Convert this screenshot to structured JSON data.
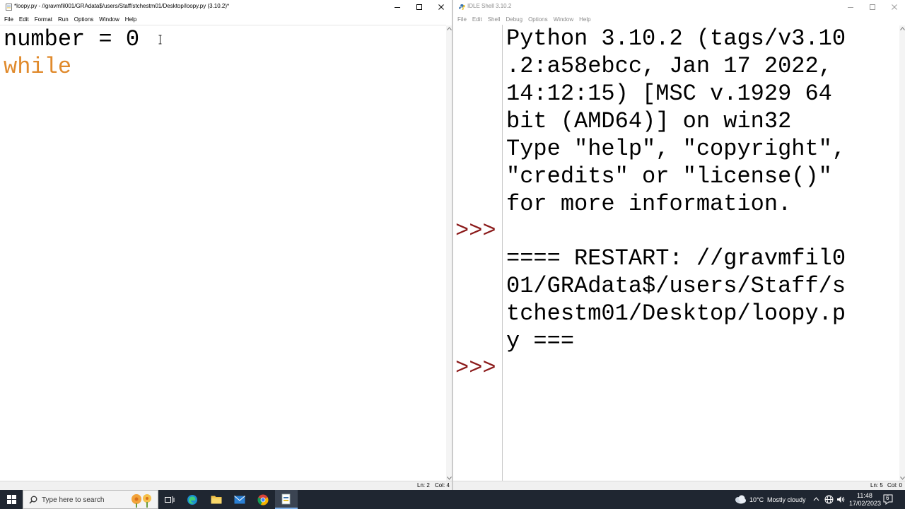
{
  "editor": {
    "title": "*loopy.py - //gravmfil001/GRAdata$/users/Staff/stchestm01/Desktop/loopy.py (3.10.2)*",
    "menu": [
      "File",
      "Edit",
      "Format",
      "Run",
      "Options",
      "Window",
      "Help"
    ],
    "code": {
      "line1": "number = 0",
      "line2_keyword": "while"
    },
    "status": {
      "line": "Ln: 2",
      "col": "Col: 4"
    }
  },
  "shell": {
    "title": "IDLE Shell 3.10.2",
    "menu": [
      "File",
      "Edit",
      "Shell",
      "Debug",
      "Options",
      "Window",
      "Help"
    ],
    "lines": [
      "Python 3.10.2 (tags/v3.10",
      ".2:a58ebcc, Jan 17 2022,",
      "14:12:15) [MSC v.1929 64",
      "bit (AMD64)] on win32",
      "Type \"help\", \"copyright\",",
      "\"credits\" or \"license()\"",
      "for more information.",
      "",
      "==== RESTART: //gravmfil0",
      "01/GRAdata$/users/Staff/s",
      "tchestm01/Desktop/loopy.p",
      "y ==="
    ],
    "prompt": ">>>",
    "status": {
      "line": "Ln: 5",
      "col": "Col: 0"
    }
  },
  "taskbar": {
    "search_placeholder": "Type here to search",
    "weather": {
      "temp": "10°C",
      "condition": "Mostly cloudy"
    },
    "clock": {
      "time": "11:48",
      "date": "17/02/2023"
    },
    "notifications": "6"
  },
  "colors": {
    "keyword": "#e08a2c",
    "prompt": "#8b1a1a",
    "taskbar": "#1f2631"
  }
}
